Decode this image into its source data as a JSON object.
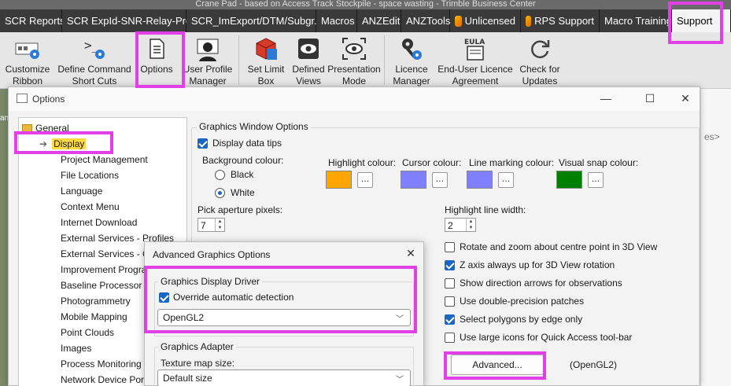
{
  "window_title": "Crane Pad - based on Access Track Stockpile - space wasting - Trimble Business Center",
  "ribbon_tabs": [
    {
      "label": "SCR Reports"
    },
    {
      "label": "SCR ExpId-SNR-Relay-Prop"
    },
    {
      "label": "SCR_ImExport/DTM/Subgr..."
    },
    {
      "label": "Macros"
    },
    {
      "label": "ANZEdit"
    },
    {
      "label": "ANZTools"
    },
    {
      "label": "Unlicensed"
    },
    {
      "label": "RPS Support"
    },
    {
      "label": "Macro Training"
    },
    {
      "label": "Support"
    }
  ],
  "ribbon_buttons": [
    {
      "label": "Customize Ribbon",
      "icon": "customize-ribbon-icon"
    },
    {
      "label": "Define Command Short Cuts",
      "icon": "command-shortcut-icon"
    },
    {
      "label": "Options",
      "icon": "options-icon"
    },
    {
      "label": "User Profile Manager",
      "icon": "user-profile-icon"
    },
    {
      "label": "Set Limit Box",
      "icon": "limit-box-icon"
    },
    {
      "label": "Defined Views",
      "icon": "eye-icon"
    },
    {
      "label": "Presentation Mode",
      "icon": "presentation-eye-icon"
    },
    {
      "label": "Licence Manager",
      "icon": "key-icon"
    },
    {
      "label": "End-User Licence Agreement",
      "icon": "eula-icon"
    },
    {
      "label": "Check for Updates",
      "icon": "refresh-icon"
    }
  ],
  "options_dialog": {
    "title": "Options",
    "tree": {
      "root": "General",
      "items": [
        "Display",
        "Project Management",
        "File Locations",
        "Language",
        "Context Menu",
        "Internet Download",
        "External Services - Profiles",
        "External Services - Options",
        "Improvement Program",
        "Baseline Processor",
        "Photogrammetry",
        "Mobile Mapping",
        "Point Clouds",
        "Images",
        "Process Monitoring",
        "Network Device Port"
      ],
      "selected": "Display"
    },
    "graphics_window_options": {
      "group_label": "Graphics Window Options",
      "display_data_tips": {
        "label": "Display data tips",
        "checked": true
      },
      "background_colour": {
        "label": "Background colour:",
        "options": [
          "Black",
          "White"
        ],
        "selected": "White"
      },
      "highlight_colour": {
        "label": "Highlight colour:",
        "color": "#ffa500"
      },
      "cursor_colour": {
        "label": "Cursor colour:",
        "color": "#8080ff"
      },
      "line_marking_colour": {
        "label": "Line marking colour:",
        "color": "#8080ff"
      },
      "visual_snap_colour": {
        "label": "Visual snap colour:",
        "color": "#008000"
      },
      "pick_aperture": {
        "label": "Pick aperture pixels:",
        "value": "7"
      },
      "highlight_line_width": {
        "label": "Highlight line width:",
        "value": "2"
      },
      "right_options": [
        {
          "label": "Rotate and zoom about centre point in 3D View",
          "checked": false
        },
        {
          "label": "Z axis always up for 3D View rotation",
          "checked": true
        },
        {
          "label": "Show direction arrows for observations",
          "checked": false
        },
        {
          "label": "Use double-precision patches",
          "checked": false
        },
        {
          "label": "Select polygons by edge only",
          "checked": true
        },
        {
          "label": "Use large icons for Quick Access tool-bar",
          "checked": false
        }
      ],
      "advanced_button": "Advanced...",
      "driver_status": "(OpenGL2)"
    }
  },
  "advanced_dialog": {
    "title": "Advanced Graphics Options",
    "driver_group": "Graphics Display Driver",
    "override": {
      "label": "Override automatic detection",
      "checked": true
    },
    "driver_value": "OpenGL2",
    "adapter_group": "Graphics Adapter",
    "texture_label": "Texture map size:",
    "texture_value": "Default size"
  },
  "partial_text": {
    "right_edge": "es>",
    "left_edge": "an"
  },
  "colors": {
    "highlight_frame": "#e040e6",
    "accent": "#1a66c2"
  }
}
